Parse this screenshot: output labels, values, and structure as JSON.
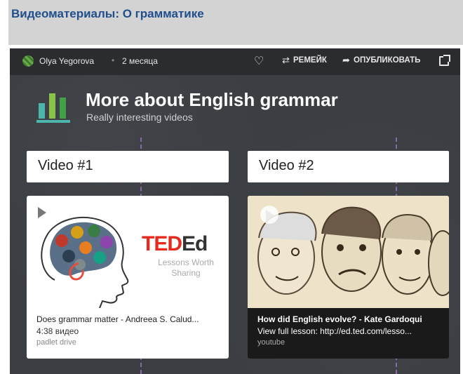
{
  "page": {
    "title": "Видеоматериалы: О грамматике"
  },
  "topbar": {
    "author": "Olya Yegorova",
    "separator": "•",
    "time_ago": "2 месяца",
    "remake_label": "РЕМЕЙК",
    "publish_label": "ОПУБЛИКОВАТЬ",
    "heart_glyph": "♡",
    "remake_glyph": "⇄",
    "publish_glyph": "➦"
  },
  "board": {
    "title": "More about English grammar",
    "subtitle": "Really interesting videos",
    "icon_colors": [
      "#4db6ac",
      "#8bc34a",
      "#43a047"
    ]
  },
  "columns": [
    {
      "header": "Video #1",
      "card": {
        "title": "Does grammar matter - Andreea S. Calud...",
        "description": "4:38 видео",
        "source": "padlet drive",
        "logo_ted": "TED",
        "logo_ed": "Ed",
        "tagline": "Lessons Worth Sharing"
      }
    },
    {
      "header": "Video #2",
      "card": {
        "title": "How did English evolve? - Kate Gardoqui",
        "description": "View full lesson: http://ed.ted.com/lesso...",
        "source": "youtube"
      }
    }
  ],
  "colors": {
    "header_bg": "#d3d3d3",
    "title_blue": "#1f4e8c",
    "board_bg": "#3b3e42",
    "column_divider": "#a078c8",
    "ted_red": "#e62b1e"
  }
}
